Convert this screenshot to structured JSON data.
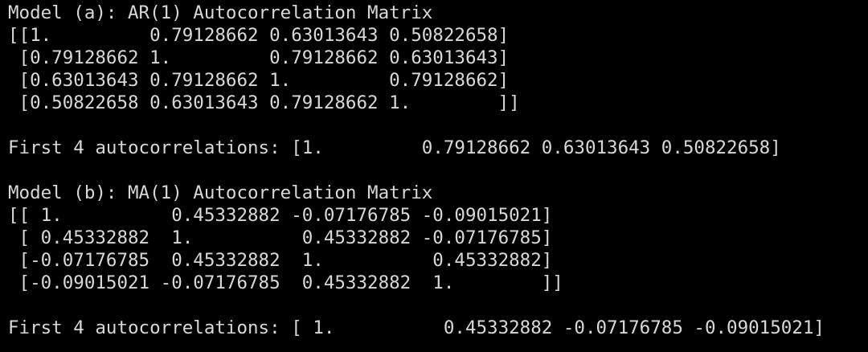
{
  "colors": {
    "background": "#000000",
    "text": "#d8d8d8"
  },
  "output": {
    "ar": {
      "title": "Model (a): AR(1) Autocorrelation Matrix",
      "matrix_rows": [
        "[[1.         0.79128662 0.63013643 0.50822658]",
        " [0.79128662 1.         0.79128662 0.63013643]",
        " [0.63013643 0.79128662 1.         0.79128662]",
        " [0.50822658 0.63013643 0.79128662 1.        ]]"
      ],
      "first_autocorrelations": "First 4 autocorrelations: [1.         0.79128662 0.63013643 0.50822658]"
    },
    "ma": {
      "title": "Model (b): MA(1) Autocorrelation Matrix",
      "matrix_rows": [
        "[[ 1.          0.45332882 -0.07176785 -0.09015021]",
        " [ 0.45332882  1.          0.45332882 -0.07176785]",
        " [-0.07176785  0.45332882  1.          0.45332882]",
        " [-0.09015021 -0.07176785  0.45332882  1.        ]]"
      ],
      "first_autocorrelations": "First 4 autocorrelations: [ 1.          0.45332882 -0.07176785 -0.09015021]"
    }
  }
}
